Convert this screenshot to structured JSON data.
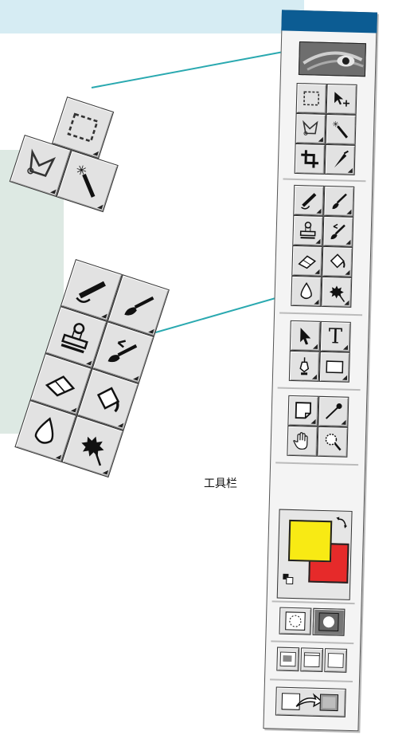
{
  "label": "工具栏",
  "colors": {
    "foreground": "#f8ea14",
    "background": "#e62a2a",
    "title_bar": "#0c5c93",
    "callout_line": "#2aa9b0"
  },
  "toolbox": {
    "tools": [
      {
        "name": "rectangular-marquee-tool",
        "icon": "marquee-icon"
      },
      {
        "name": "move-tool",
        "icon": "move-icon"
      },
      {
        "name": "lasso-tool",
        "icon": "lasso-icon"
      },
      {
        "name": "magic-wand-tool",
        "icon": "magic-wand-icon"
      },
      {
        "name": "crop-tool",
        "icon": "crop-icon"
      },
      {
        "name": "slice-tool",
        "icon": "slice-icon"
      },
      {
        "name": "healing-brush-tool",
        "icon": "healing-brush-icon"
      },
      {
        "name": "brush-tool",
        "icon": "brush-icon"
      },
      {
        "name": "clone-stamp-tool",
        "icon": "stamp-icon"
      },
      {
        "name": "history-brush-tool",
        "icon": "history-brush-icon"
      },
      {
        "name": "eraser-tool",
        "icon": "eraser-icon"
      },
      {
        "name": "paint-bucket-tool",
        "icon": "bucket-icon"
      },
      {
        "name": "blur-tool",
        "icon": "drop-icon"
      },
      {
        "name": "dodge-tool",
        "icon": "sponge-icon"
      },
      {
        "name": "path-selection-tool",
        "icon": "arrow-icon"
      },
      {
        "name": "type-tool",
        "icon": "type-icon",
        "glyph": "T"
      },
      {
        "name": "pen-tool",
        "icon": "pen-icon"
      },
      {
        "name": "shape-tool",
        "icon": "rectangle-icon"
      },
      {
        "name": "notes-tool",
        "icon": "notes-icon"
      },
      {
        "name": "eyedropper-tool",
        "icon": "eyedropper-icon"
      },
      {
        "name": "hand-tool",
        "icon": "hand-icon"
      },
      {
        "name": "zoom-tool",
        "icon": "zoom-icon"
      }
    ]
  }
}
